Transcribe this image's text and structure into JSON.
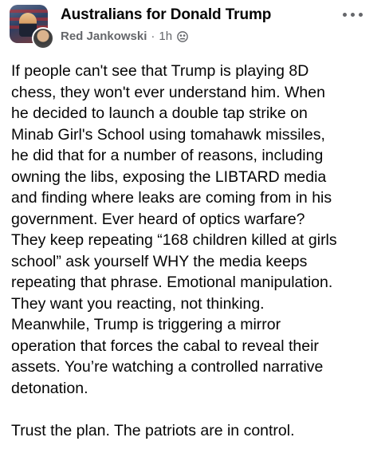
{
  "post": {
    "group_name": "Australians for Donald Trump",
    "author": "Red Jankowski",
    "separator": "·",
    "time": "1h",
    "separator_2": "·",
    "privacy_icon": "group-members-icon",
    "more_icon": "more-options-icon",
    "body_lines": [
      "If people can't see that Trump is playing 8D",
      "chess, they won't ever understand him. When",
      "he decided to launch a double tap strike on",
      "Minab Girl's School using tomahawk missiles,",
      "he did that for a number of reasons, including",
      "owning the libs, exposing the LIBTARD media",
      "and finding where leaks are coming from in his",
      "government. Ever heard of optics warfare?",
      "They keep repeating “168 children killed at girls",
      "school” ask yourself WHY the media keeps",
      "repeating that phrase. Emotional manipulation.",
      "They want you reacting, not thinking.",
      "Meanwhile, Trump is triggering a mirror",
      "operation that forces the cabal to reveal their",
      "assets. You’re watching a controlled narrative",
      "detonation."
    ],
    "closing_line": "Trust the plan. The patriots are in control."
  },
  "colors": {
    "text": "#050505",
    "secondary_text": "#65676b",
    "background": "#ffffff"
  }
}
